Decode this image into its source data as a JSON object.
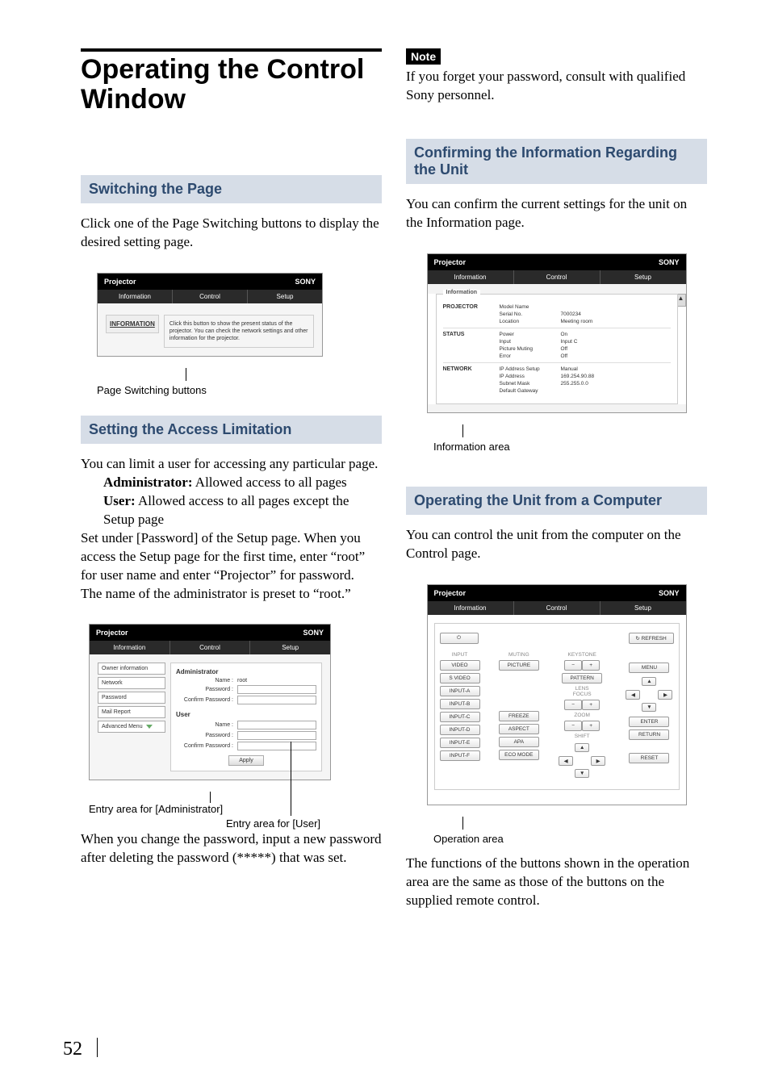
{
  "pageNumber": "52",
  "left": {
    "title": "Operating the Control Window",
    "sec1": {
      "head": "Switching the Page",
      "p1": "Click one of the Page Switching buttons to display the desired setting page.",
      "fig": {
        "tabs": [
          "Information",
          "Control",
          "Setup"
        ],
        "brand": "SONY",
        "name": "Projector",
        "btnLabel": "INFORMATION",
        "desc": "Click this button to show the present status of the projector. You can check the network settings and other information for the projector."
      },
      "figCap": "Page Switching buttons"
    },
    "sec2": {
      "head": "Setting the Access Limitation",
      "p1": "You can limit a user for accessing any particular page.",
      "adminBold": "Administrator:",
      "adminText": " Allowed access to all pages",
      "userBold": "User:",
      "userText": " Allowed access to all pages except the Setup page",
      "p2": "Set under [Password] of the Setup page. When you access the Setup page for the first time, enter “root” for user name and enter “Projector” for password.",
      "p3": "The name of the administrator is preset to “root.”",
      "fig": {
        "name": "Projector",
        "brand": "SONY",
        "tabs": [
          "Information",
          "Control",
          "Setup"
        ],
        "side": [
          "Owner information",
          "Network",
          "Password",
          "Mail Report",
          "Advanced Menu"
        ],
        "adminTitle": "Administrator",
        "nameLbl": "Name :",
        "nameVal": "root",
        "pwdLbl": "Password :",
        "cpwdLbl": "Confirm Password :",
        "userTitle": "User",
        "apply": "Apply"
      },
      "cap1": "Entry area for [Administrator]",
      "cap2": "Entry area for [User]",
      "p4": "When you change the password, input a new password after deleting the password (*****) that was set."
    }
  },
  "right": {
    "noteChip": "Note",
    "noteText": "If you forget your password, consult with qualified Sony personnel.",
    "sec3": {
      "head": "Confirming the Information Regarding the Unit",
      "p1": "You can confirm the current settings for the unit on the Information page.",
      "fig": {
        "name": "Projector",
        "brand": "SONY",
        "tabs": [
          "Information",
          "Control",
          "Setup"
        ],
        "panelLabel": "Information",
        "groups": [
          {
            "title": "PROJECTOR",
            "rows": [
              [
                "Model Name",
                ""
              ],
              [
                "Serial No.",
                "7000234"
              ],
              [
                "Location",
                "Meeting room"
              ]
            ]
          },
          {
            "title": "STATUS",
            "rows": [
              [
                "Power",
                "On"
              ],
              [
                "Input",
                "Input C"
              ],
              [
                "Picture Muting",
                "Off"
              ],
              [
                "Error",
                "Off"
              ]
            ]
          },
          {
            "title": "NETWORK",
            "rows": [
              [
                "IP Address Setup",
                "Manual"
              ],
              [
                "IP Address",
                "169.254.90.88"
              ],
              [
                "Subnet Mask",
                "255.255.0.0"
              ],
              [
                "Default Gateway",
                ""
              ]
            ]
          }
        ]
      },
      "figCap": "Information area"
    },
    "sec4": {
      "head": "Operating the Unit from a Computer",
      "p1": "You can control the unit from the computer on the Control page.",
      "fig": {
        "name": "Projector",
        "brand": "SONY",
        "tabs": [
          "Information",
          "Control",
          "Setup"
        ],
        "power": "⏻",
        "refresh": "↻ REFRESH",
        "inputLabel": "INPUT",
        "inputBtns": [
          "VIDEO",
          "S VIDEO",
          "INPUT-A",
          "INPUT-B",
          "INPUT-C",
          "INPUT-D",
          "INPUT-E",
          "INPUT-F"
        ],
        "col2Label": "MUTING",
        "col2Btn": "PICTURE",
        "freeze": "FREEZE",
        "aspect": "ASPECT",
        "apa": "APA",
        "eco": "ECO MODE",
        "keystone": "KEYSTONE",
        "pattern": "PATTERN",
        "lensfocus": "LENS\nFOCUS",
        "zoom": "ZOOM",
        "shift": "SHIFT",
        "menu": "MENU",
        "enter": "ENTER",
        "return": "RETURN",
        "reset": "RESET"
      },
      "figCap": "Operation area",
      "p2": "The functions of the buttons shown in the operation area are the same as those of the buttons on the supplied remote control."
    }
  }
}
